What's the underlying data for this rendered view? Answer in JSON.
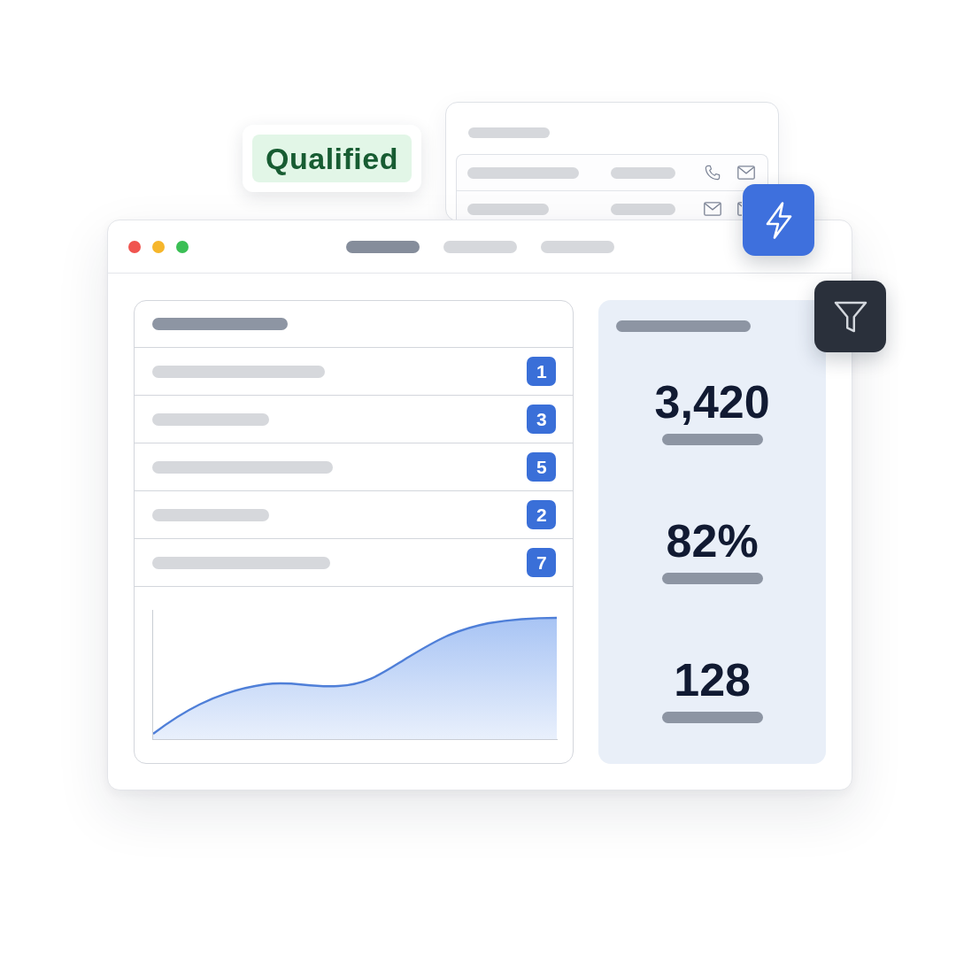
{
  "status_badge": {
    "label": "Qualified"
  },
  "nav_tabs": [
    {
      "selected": true
    },
    {
      "selected": false
    },
    {
      "selected": false
    }
  ],
  "list_rows": [
    {
      "count": "1"
    },
    {
      "count": "3"
    },
    {
      "count": "5"
    },
    {
      "count": "2"
    },
    {
      "count": "7"
    }
  ],
  "stats": [
    {
      "value": "3,420"
    },
    {
      "value": "82%"
    },
    {
      "value": "128"
    }
  ]
}
